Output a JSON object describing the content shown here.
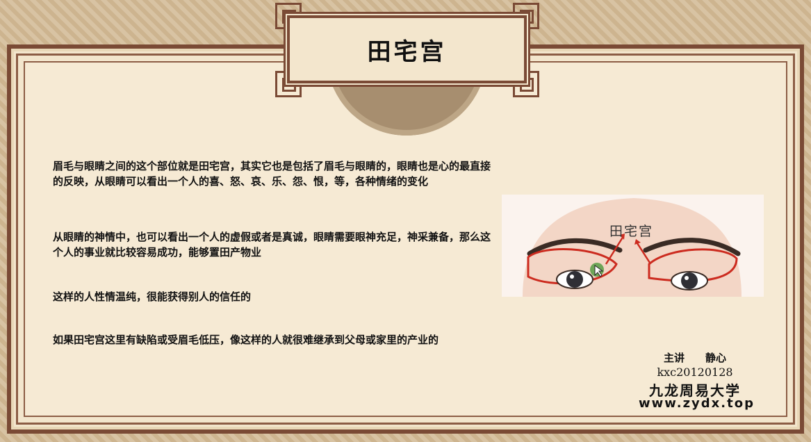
{
  "slide": {
    "title": "田宅宫",
    "paragraphs": [
      "眉毛与眼睛之间的这个部位就是田宅宫，其实它也是包括了眉毛与眼睛的，眼睛也是心的最直接的反映，从眼睛可以看出一个人的喜、怒、哀、乐、怨、恨，等，各种情绪的变化",
      "从眼睛的神情中，也可以看出一个人的虚假或者是真诚，眼睛需要眼神充足，神采兼备，那么这个人的事业就比较容易成功，能够置田产物业",
      "这样的人性情温纯，很能获得别人的信任的",
      "如果田宅宫这里有缺陷或受眉毛低压，像这样的人就很难继承到父母或家里的产业的"
    ],
    "image_label": "田宅宫",
    "credit": {
      "speaker": "主讲　　静心",
      "id": "kxc20120128",
      "org": "九龙周易大学",
      "url": "www.zydx.top"
    }
  }
}
